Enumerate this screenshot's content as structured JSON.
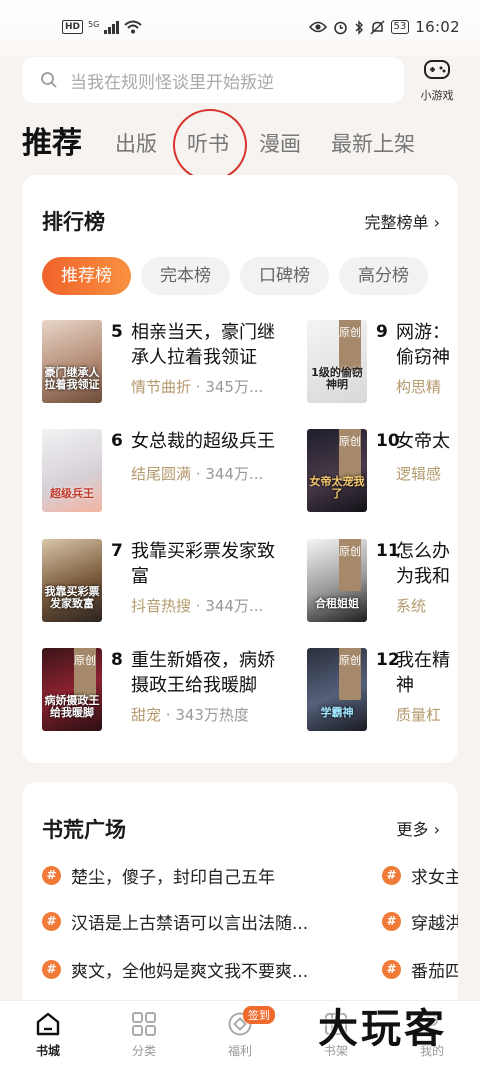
{
  "status_bar": {
    "hd": "HD",
    "signal": "5G",
    "battery": "53",
    "time": "16:02"
  },
  "search": {
    "placeholder": "当我在规则怪谈里开始叛逆"
  },
  "game": {
    "label": "小游戏"
  },
  "tabs": [
    "推荐",
    "出版",
    "听书",
    "漫画",
    "最新上架"
  ],
  "ranking": {
    "title": "排行榜",
    "more": "完整榜单",
    "pills": [
      "推荐榜",
      "完本榜",
      "口碑榜",
      "高分榜"
    ],
    "books": [
      {
        "rank": "5",
        "title_l1": "相亲当天，豪门继",
        "title_l2": "承人拉着我领证",
        "tag": "情节曲折",
        "heat": "345万...",
        "cover_text": "豪门继承人拉着我领证",
        "original": ""
      },
      {
        "rank": "6",
        "title_l1": "女总裁的超级兵王",
        "title_l2": "",
        "tag": "结尾圆满",
        "heat": "344万...",
        "cover_text": "超级兵王",
        "original": ""
      },
      {
        "rank": "7",
        "title_l1": "我靠买彩票发家致",
        "title_l2": "富",
        "tag": "抖音热搜",
        "heat": "344万...",
        "cover_text": "我靠买彩票发家致富",
        "original": ""
      },
      {
        "rank": "8",
        "title_l1": "重生新婚夜，病娇",
        "title_l2": "摄政王给我暖脚",
        "tag": "甜宠",
        "heat": "343万热度",
        "cover_text": "病娇摄政王给我暖脚",
        "original": "原创"
      },
      {
        "rank": "9",
        "title_l1": "网游：",
        "title_l2": "偷窃神",
        "tag": "构思精",
        "heat": "",
        "cover_text": "1级的偷窃神明",
        "original": "原创"
      },
      {
        "rank": "10",
        "title_l1": "女帝太",
        "title_l2": "",
        "tag": "逻辑感",
        "heat": "",
        "cover_text": "女帝太宠我了",
        "original": "原创"
      },
      {
        "rank": "11",
        "title_l1": "怎么办",
        "title_l2": "为我和",
        "tag": "系统",
        "heat": "",
        "cover_text": "合租姐姐",
        "original": "原创"
      },
      {
        "rank": "12",
        "title_l1": "我在精",
        "title_l2": "神",
        "tag": "质量杠",
        "heat": "",
        "cover_text": "学霸神",
        "original": "原创"
      }
    ]
  },
  "square": {
    "title": "书荒广场",
    "more": "更多",
    "topics_left": [
      "楚尘，傻子，封印自己五年",
      "汉语是上古禁语可以言出法随...",
      "爽文，全他妈是爽文我不要爽..."
    ],
    "topics_right": [
      "求女主",
      "穿越洪",
      "番茄四"
    ]
  },
  "nav": {
    "items": [
      "书城",
      "分类",
      "福利",
      "书架",
      "我的"
    ],
    "badge": "签到"
  },
  "watermark": "大玩客",
  "colors": {
    "accent": "#f0622b",
    "tag": "#b59a6d",
    "circle": "#d8332c"
  }
}
